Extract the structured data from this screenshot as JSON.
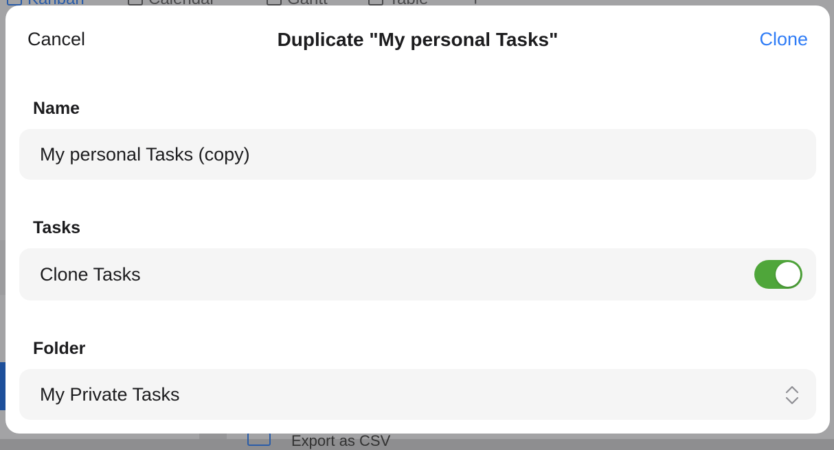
{
  "background": {
    "tabs": [
      {
        "label": "Kanban",
        "active": true
      },
      {
        "label": "Calendar"
      },
      {
        "label": "Gantt"
      },
      {
        "label": "Table"
      }
    ],
    "bottom_text": "Export as CSV"
  },
  "dialog": {
    "cancel_label": "Cancel",
    "title": "Duplicate \"My personal Tasks\"",
    "clone_label": "Clone",
    "name_section": "Name",
    "name_value": "My personal Tasks (copy)",
    "tasks_section": "Tasks",
    "clone_tasks_label": "Clone Tasks",
    "clone_tasks_on": true,
    "folder_section": "Folder",
    "folder_value": "My Private Tasks"
  },
  "colors": {
    "accent": "#2f7cf6",
    "toggle_on": "#4fa63a",
    "field_bg": "#f5f5f5"
  }
}
